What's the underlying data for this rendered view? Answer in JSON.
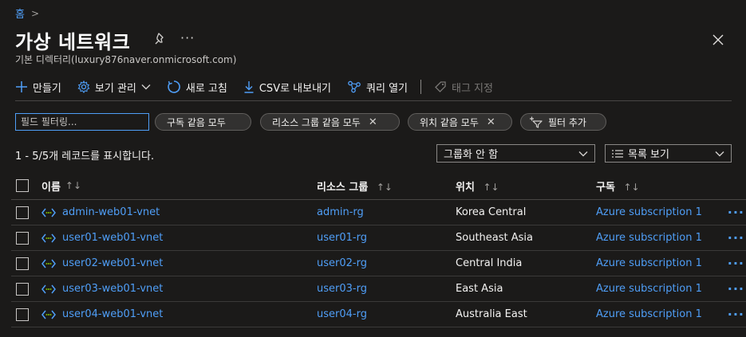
{
  "breadcrumb": {
    "home": "홈",
    "separator": ">"
  },
  "header": {
    "title": "가상 네트워크",
    "more": "···",
    "subtitle": "기본 디렉터리(luxury876naver.onmicrosoft.com)"
  },
  "toolbar": {
    "create": "만들기",
    "manage_view": "보기 관리",
    "refresh": "새로 고침",
    "export_csv": "CSV로 내보내기",
    "open_query": "쿼리 열기",
    "assign_tags": "태그 지정"
  },
  "filters": {
    "search_placeholder": "필드 필터링...",
    "subscription": "구독 같음 모두",
    "resource_group": "리소스 그룹 같음 모두",
    "location": "위치 같음 모두",
    "add_filter": "필터 추가",
    "remove": "✕"
  },
  "records_text": "1 - 5/5개 레코드를 표시합니다.",
  "grouping": {
    "selected": "그룹화 안 함"
  },
  "view": {
    "selected": "목록 보기"
  },
  "table": {
    "columns": {
      "name": "이름",
      "resource_group": "리소스 그룹",
      "location": "위치",
      "subscription": "구독",
      "sort": "↑↓"
    },
    "more": "···",
    "rows": [
      {
        "name": "admin-web01-vnet",
        "resource_group": "admin-rg",
        "location": "Korea Central",
        "subscription": "Azure subscription 1"
      },
      {
        "name": "user01-web01-vnet",
        "resource_group": "user01-rg",
        "location": "Southeast Asia",
        "subscription": "Azure subscription 1"
      },
      {
        "name": "user02-web01-vnet",
        "resource_group": "user02-rg",
        "location": "Central India",
        "subscription": "Azure subscription 1"
      },
      {
        "name": "user03-web01-vnet",
        "resource_group": "user03-rg",
        "location": "East Asia",
        "subscription": "Azure subscription 1"
      },
      {
        "name": "user04-web01-vnet",
        "resource_group": "user04-rg",
        "location": "Australia East",
        "subscription": "Azure subscription 1"
      }
    ]
  },
  "colors": {
    "accent": "#4f9ef7",
    "background": "#1b1a19",
    "icon_green": "#7fba00"
  }
}
